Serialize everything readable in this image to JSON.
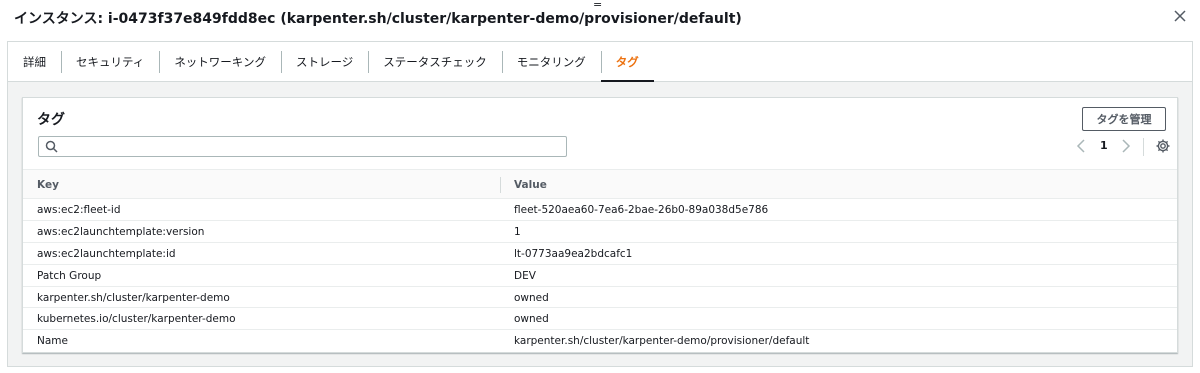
{
  "header": {
    "title": "インスタンス: i-0473f37e849fdd8ec (karpenter.sh/cluster/karpenter-demo/provisioner/default)",
    "mark": "="
  },
  "tabs": [
    {
      "label": "詳細"
    },
    {
      "label": "セキュリティ"
    },
    {
      "label": "ネットワーキング"
    },
    {
      "label": "ストレージ"
    },
    {
      "label": "ステータスチェック"
    },
    {
      "label": "モニタリング"
    },
    {
      "label": "タグ",
      "active": true
    }
  ],
  "tags_panel": {
    "title": "タグ",
    "manage_button": "タグを管理",
    "search_placeholder": "",
    "page": "1",
    "columns": {
      "key": "Key",
      "value": "Value"
    },
    "rows": [
      {
        "key": "aws:ec2:fleet-id",
        "value": "fleet-520aea60-7ea6-2bae-26b0-89a038d5e786"
      },
      {
        "key": "aws:ec2launchtemplate:version",
        "value": "1"
      },
      {
        "key": "aws:ec2launchtemplate:id",
        "value": "lt-0773aa9ea2bdcafc1"
      },
      {
        "key": "Patch Group",
        "value": "DEV"
      },
      {
        "key": "karpenter.sh/cluster/karpenter-demo",
        "value": "owned"
      },
      {
        "key": "kubernetes.io/cluster/karpenter-demo",
        "value": "owned"
      },
      {
        "key": "Name",
        "value": "karpenter.sh/cluster/karpenter-demo/provisioner/default"
      }
    ]
  },
  "colors": {
    "active_tab": "#ec7211",
    "text": "#16191f",
    "border": "#d5dbdb"
  }
}
